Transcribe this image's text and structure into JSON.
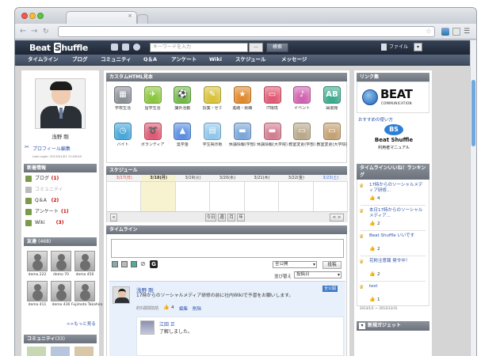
{
  "header": {
    "logo": "Beat",
    "logo_s": "S",
    "logo_rest": "huffle",
    "search_placeholder": "キーワードを入力",
    "search_scope": "---",
    "search_button": "検索",
    "file_label": "ファイル"
  },
  "menu": [
    "タイムライン",
    "ブログ",
    "コミュニティ",
    "Q＆A",
    "アンケート",
    "Wiki",
    "スケジュール",
    "メッセージ"
  ],
  "profile": {
    "name": "浅野 剛",
    "edit_link": "プロフィール編集",
    "last_login": "Last Login: 2013/01/01 11:08:40"
  },
  "news": {
    "title": "新着情報",
    "items": [
      {
        "label": "ブログ",
        "count": "(1)",
        "active": true
      },
      {
        "label": "コミュニティ",
        "count": "",
        "active": false
      },
      {
        "label": "Q＆A",
        "count": "(2)",
        "active": true
      },
      {
        "label": "アンケート",
        "count": "(1)",
        "active": true
      },
      {
        "label": "Wiki",
        "count": "(3)",
        "active": true
      }
    ]
  },
  "friends": {
    "title": "友達",
    "count": "(468)",
    "items": [
      {
        "label": "demo 222"
      },
      {
        "label": "demo 70"
      },
      {
        "label": "demo 450"
      },
      {
        "label": "demo 411"
      },
      {
        "label": "demo 436"
      },
      {
        "label": "Fujimoto Takahiro"
      }
    ],
    "more": ">>もっと見る"
  },
  "community": {
    "title": "コミュニティ",
    "count": "(33)"
  },
  "custom_html": {
    "title": "カスタムHTML見本",
    "tiles": [
      {
        "label": "学校生活",
        "icon": "school-icon",
        "color": "#8a8f96",
        "glyph": "▦"
      },
      {
        "label": "留学生活",
        "icon": "airplane-icon",
        "color": "#8cc63f",
        "glyph": "✈"
      },
      {
        "label": "課外活動",
        "icon": "soccer-icon",
        "color": "#73b94a",
        "glyph": "⚽"
      },
      {
        "label": "授業・ゼミ",
        "icon": "pencil-icon",
        "color": "#d8c23b",
        "glyph": "✎"
      },
      {
        "label": "進路・就職",
        "icon": "star-icon",
        "color": "#e08a2e",
        "glyph": "★"
      },
      {
        "label": "IT環境",
        "icon": "monitor-icon",
        "color": "#e05a74",
        "glyph": "▭"
      },
      {
        "label": "イベント",
        "icon": "music-icon",
        "color": "#d063b0",
        "glyph": "♪"
      },
      {
        "label": "図書館",
        "icon": "book-icon",
        "color": "#3cab8e",
        "glyph": "AB"
      },
      {
        "label": "バイト",
        "icon": "clock-icon",
        "color": "#49a7d9",
        "glyph": "◷"
      },
      {
        "label": "ボランティア",
        "icon": "ribbon-icon",
        "color": "#df5a74",
        "glyph": "➰"
      },
      {
        "label": "奨学金",
        "icon": "graduation-cap-icon",
        "color": "#5a8fe0",
        "glyph": "▲"
      },
      {
        "label": "学生掲示板",
        "icon": "chat-icon",
        "color": "#8fc6ea",
        "glyph": "▤"
      },
      {
        "label": "休講情報(学部)",
        "icon": "bed-icon",
        "color": "#7ba7d9",
        "glyph": "▬"
      },
      {
        "label": "休講情報(大学院)",
        "icon": "bed-icon",
        "color": "#d37d90",
        "glyph": "▬"
      },
      {
        "label": "教室変更(学部)",
        "icon": "board-icon",
        "color": "#b8a98a",
        "glyph": "▭"
      },
      {
        "label": "教室変更(大学院)",
        "icon": "board-icon",
        "color": "#c4a274",
        "glyph": "▭"
      }
    ]
  },
  "schedule": {
    "title": "スケジュール",
    "days": [
      {
        "label": "3/17(日)",
        "color": "#d83d3d"
      },
      {
        "label": "3/18(月)",
        "color": "#333333"
      },
      {
        "label": "3/19(火)",
        "color": "#333333"
      },
      {
        "label": "3/20(水)",
        "color": "#333333"
      },
      {
        "label": "3/21(木)",
        "color": "#333333"
      },
      {
        "label": "3/22(金)",
        "color": "#333333"
      },
      {
        "label": "3/23(土)",
        "color": "#3e6fd6"
      }
    ],
    "prev": "<",
    "next": "< >",
    "buttons": [
      "今日",
      "週",
      "月",
      "年"
    ]
  },
  "timeline": {
    "title": "タイムライン",
    "scope": "全公開",
    "post_button": "投稿",
    "sort_label": "並び替え",
    "sort_value": "投稿日",
    "post": {
      "author": "浅野 剛",
      "badge": "全公開",
      "body": "17時からのソーシャルメディア研修の前に社内Wikiで予習をお願いします。",
      "meta": "約5週間前前",
      "likes": "4",
      "edit": "編集",
      "delete": "削除"
    },
    "reply": {
      "author": "江田 正",
      "body": "了解しました。"
    }
  },
  "links": {
    "title": "リンク集",
    "beat_title": "BEAT",
    "beat_sub": "COMMUNICATION",
    "manual_link": "おすすめの使い方",
    "manual_title": "Beat Shuffle",
    "manual_sub": "利用者マニュアル"
  },
  "ranking": {
    "title": "タイムラインいいね！ランキング",
    "items": [
      {
        "text": "17時からのソーシャルメディア研修...",
        "likes": "4"
      },
      {
        "text": "本日17時からのソーシャルメディア...",
        "likes": "2"
      },
      {
        "text": "Beat Shuffle いいです",
        "likes": "2"
      },
      {
        "text": "花粉注意報 発令中！",
        "likes": "2"
      },
      {
        "text": "test",
        "likes": "1"
      }
    ],
    "range": "2013/1/1 〜 2013/12/31"
  },
  "gadget": {
    "label": "新規ガジェット"
  }
}
